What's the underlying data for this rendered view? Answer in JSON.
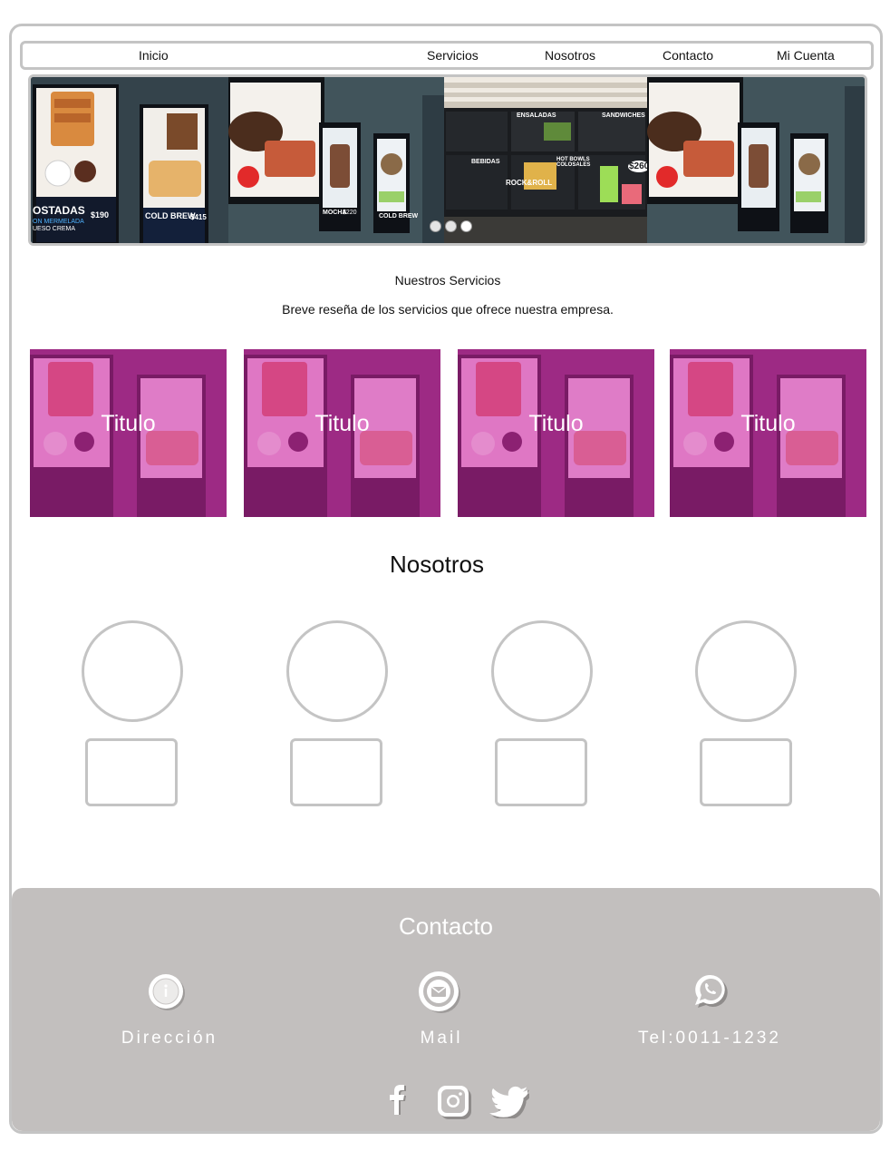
{
  "nav": {
    "items": [
      {
        "label": "Inicio"
      },
      {
        "label": "Servicios"
      },
      {
        "label": "Nosotros"
      },
      {
        "label": "Contacto"
      },
      {
        "label": "Mi Cuenta"
      }
    ]
  },
  "hero": {
    "menu_text": {
      "tostadas": "OSTADAS",
      "tostadas_price": "$190",
      "mermelada": "ON MERMELADA",
      "queso": "UESO CREMA",
      "cold_brew": "COLD BREW",
      "cold_brew_price": "$415",
      "ensaladas": "ENSALADAS",
      "sandwiches": "SANDWICHES",
      "bebidas": "BEBIDAS",
      "hot_bowls": "HOT BOWLS COLOSALES",
      "rock_roll": "ROCK&ROLL",
      "price_260": "$260",
      "mocha": "MOCHA",
      "cold_brew_2": "COLD BREW",
      "price_220": "$220"
    },
    "carousel_dots": 3,
    "active_dot": 2
  },
  "services": {
    "heading": "Nuestros Servicios",
    "subtitle": "Breve reseña de los servicios que ofrece nuestra empresa.",
    "cards": [
      {
        "title": "Titulo"
      },
      {
        "title": "Titulo"
      },
      {
        "title": "Titulo"
      },
      {
        "title": "Titulo"
      }
    ],
    "tint_color": "#c23aa2"
  },
  "about": {
    "heading": "Nosotros",
    "member_count": 4
  },
  "contact": {
    "heading": "Contacto",
    "items": [
      {
        "icon": "info-icon",
        "label": "Dirección"
      },
      {
        "icon": "mail-icon",
        "label": "Mail"
      },
      {
        "icon": "whatsapp-icon",
        "label": "Tel:0011-1232"
      }
    ],
    "social": [
      "facebook-icon",
      "instagram-icon",
      "twitter-icon"
    ],
    "background": "#c2bfbe"
  }
}
